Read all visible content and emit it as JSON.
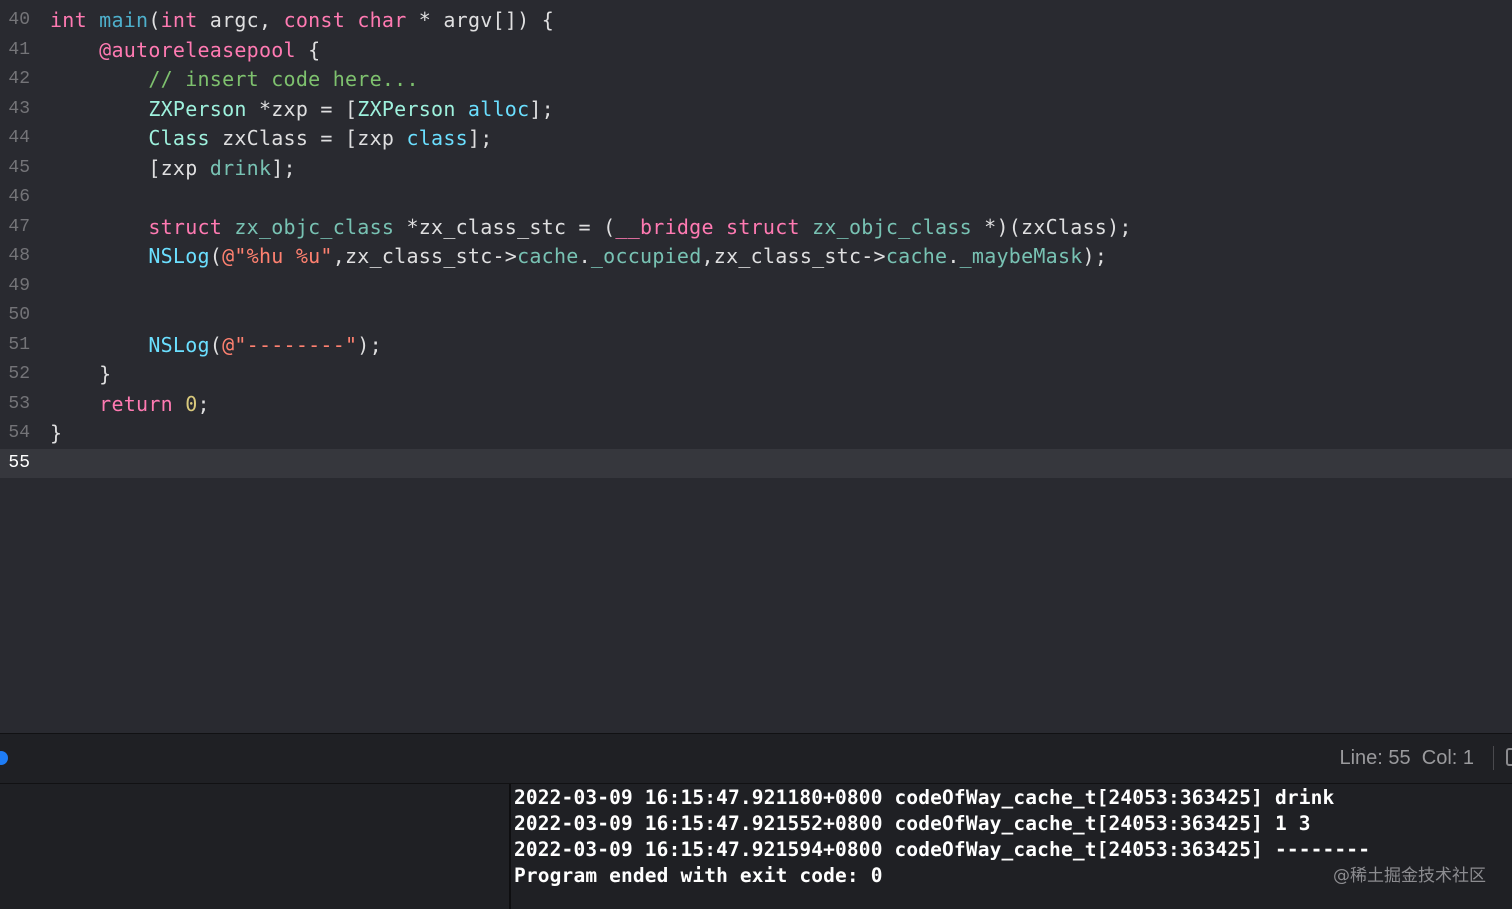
{
  "editor": {
    "lines": [
      {
        "number": "40",
        "tokens": [
          {
            "t": "int",
            "c": "kw"
          },
          {
            "t": " ",
            "c": "plain"
          },
          {
            "t": "main",
            "c": "fn"
          },
          {
            "t": "(",
            "c": "plain"
          },
          {
            "t": "int",
            "c": "kw"
          },
          {
            "t": " argc, ",
            "c": "plain"
          },
          {
            "t": "const",
            "c": "kw"
          },
          {
            "t": " ",
            "c": "plain"
          },
          {
            "t": "char",
            "c": "kw"
          },
          {
            "t": " * argv[]) {",
            "c": "plain"
          }
        ]
      },
      {
        "number": "41",
        "tokens": [
          {
            "t": "    ",
            "c": "plain"
          },
          {
            "t": "@autoreleasepool",
            "c": "kw"
          },
          {
            "t": " {",
            "c": "plain"
          }
        ]
      },
      {
        "number": "42",
        "tokens": [
          {
            "t": "        ",
            "c": "plain"
          },
          {
            "t": "// insert code here...",
            "c": "cmt"
          }
        ]
      },
      {
        "number": "43",
        "tokens": [
          {
            "t": "        ",
            "c": "plain"
          },
          {
            "t": "ZXPerson",
            "c": "cls"
          },
          {
            "t": " *zxp = [",
            "c": "plain"
          },
          {
            "t": "ZXPerson",
            "c": "cls"
          },
          {
            "t": " ",
            "c": "plain"
          },
          {
            "t": "alloc",
            "c": "meth"
          },
          {
            "t": "];",
            "c": "plain"
          }
        ]
      },
      {
        "number": "44",
        "tokens": [
          {
            "t": "        ",
            "c": "plain"
          },
          {
            "t": "Class",
            "c": "cls"
          },
          {
            "t": " zxClass = [zxp ",
            "c": "plain"
          },
          {
            "t": "class",
            "c": "meth"
          },
          {
            "t": "];",
            "c": "plain"
          }
        ]
      },
      {
        "number": "45",
        "tokens": [
          {
            "t": "        [zxp ",
            "c": "plain"
          },
          {
            "t": "drink",
            "c": "proj"
          },
          {
            "t": "];",
            "c": "plain"
          }
        ]
      },
      {
        "number": "46",
        "tokens": []
      },
      {
        "number": "47",
        "tokens": [
          {
            "t": "        ",
            "c": "plain"
          },
          {
            "t": "struct",
            "c": "kw"
          },
          {
            "t": " ",
            "c": "plain"
          },
          {
            "t": "zx_objc_class",
            "c": "proj"
          },
          {
            "t": " *zx_class_stc = (",
            "c": "plain"
          },
          {
            "t": "__bridge",
            "c": "kw"
          },
          {
            "t": " ",
            "c": "plain"
          },
          {
            "t": "struct",
            "c": "kw"
          },
          {
            "t": " ",
            "c": "plain"
          },
          {
            "t": "zx_objc_class",
            "c": "proj"
          },
          {
            "t": " *)(zxClass);",
            "c": "plain"
          }
        ]
      },
      {
        "number": "48",
        "tokens": [
          {
            "t": "        ",
            "c": "plain"
          },
          {
            "t": "NSLog",
            "c": "meth"
          },
          {
            "t": "(",
            "c": "plain"
          },
          {
            "t": "@\"%hu %u\"",
            "c": "str"
          },
          {
            "t": ",zx_class_stc->",
            "c": "plain"
          },
          {
            "t": "cache",
            "c": "proj"
          },
          {
            "t": ".",
            "c": "plain"
          },
          {
            "t": "_occupied",
            "c": "proj"
          },
          {
            "t": ",zx_class_stc->",
            "c": "plain"
          },
          {
            "t": "cache",
            "c": "proj"
          },
          {
            "t": ".",
            "c": "plain"
          },
          {
            "t": "_maybeMask",
            "c": "proj"
          },
          {
            "t": ");",
            "c": "plain"
          }
        ]
      },
      {
        "number": "49",
        "tokens": []
      },
      {
        "number": "50",
        "tokens": []
      },
      {
        "number": "51",
        "tokens": [
          {
            "t": "        ",
            "c": "plain"
          },
          {
            "t": "NSLog",
            "c": "meth"
          },
          {
            "t": "(",
            "c": "plain"
          },
          {
            "t": "@\"--------\"",
            "c": "str"
          },
          {
            "t": ");",
            "c": "plain"
          }
        ]
      },
      {
        "number": "52",
        "tokens": [
          {
            "t": "    }",
            "c": "plain"
          }
        ]
      },
      {
        "number": "53",
        "tokens": [
          {
            "t": "    ",
            "c": "plain"
          },
          {
            "t": "return",
            "c": "kw"
          },
          {
            "t": " ",
            "c": "plain"
          },
          {
            "t": "0",
            "c": "num"
          },
          {
            "t": ";",
            "c": "plain"
          }
        ]
      },
      {
        "number": "54",
        "tokens": [
          {
            "t": "}",
            "c": "plain"
          }
        ]
      },
      {
        "number": "55",
        "tokens": [],
        "current": true
      }
    ]
  },
  "status_bar": {
    "cursor_position": "Line: 55  Col: 1"
  },
  "console": {
    "lines": [
      "2022-03-09 16:15:47.921180+0800 codeOfWay_cache_t[24053:363425] drink",
      "2022-03-09 16:15:47.921552+0800 codeOfWay_cache_t[24053:363425] 1 3",
      "2022-03-09 16:15:47.921594+0800 codeOfWay_cache_t[24053:363425] --------",
      "Program ended with exit code: 0"
    ]
  },
  "watermark": "@稀土掘金技术社区",
  "colors": {
    "editor_background": "#292a30",
    "current_line_highlight": "#36373d",
    "keyword": "#ff7ab2",
    "comment": "#7ec16e",
    "string": "#ff8170",
    "number": "#d9c97c",
    "method": "#6bdfff",
    "class_name": "#9ef1dd",
    "project_symbol": "#78c2b3",
    "breakpoint_dot": "#1e7cf5",
    "console_background": "#1f2024"
  }
}
